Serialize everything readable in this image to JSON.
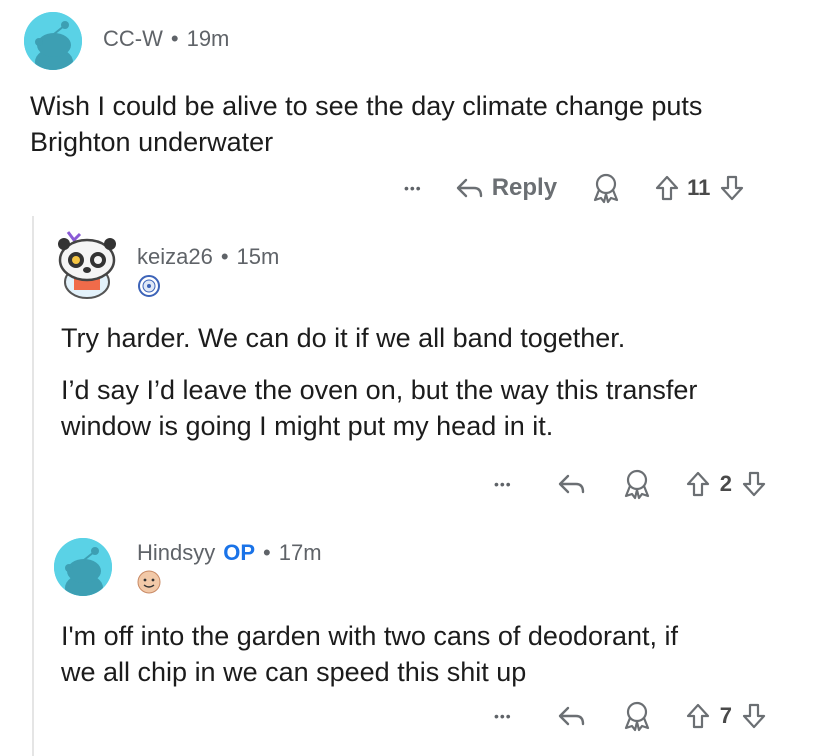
{
  "comments": [
    {
      "username": "CC-W",
      "separator": "•",
      "time": "19m",
      "body": [
        "Wish I could be alive to see the day climate change puts",
        "Brighton underwater"
      ],
      "reply_label": "Reply",
      "more": "•••",
      "votes": "11",
      "avatar_icon": "snoo-avatar-icon"
    },
    {
      "username": "keiza26",
      "separator": "•",
      "time": "15m",
      "body": [
        "Try harder. We can do it if we all band together."
      ],
      "body2": [
        "I’d say I’d leave the oven on, but the way this transfer",
        "window is going I might put my head in it."
      ],
      "more": "•••",
      "votes": "2",
      "avatar_icon": "panda-avatar-icon"
    },
    {
      "username": "Hindsyy",
      "op_badge": "OP",
      "separator": "•",
      "time": "17m",
      "body": [
        "I'm off into the garden with two cans of deodorant, if",
        "we all chip in we can speed this shit up"
      ],
      "more": "•••",
      "votes": "7",
      "avatar_icon": "snoo-avatar-icon"
    }
  ],
  "colors": {
    "snoo_bg": "#5ad2e6",
    "op_blue": "#1a73e8",
    "meta_gray": "#5f6368"
  }
}
